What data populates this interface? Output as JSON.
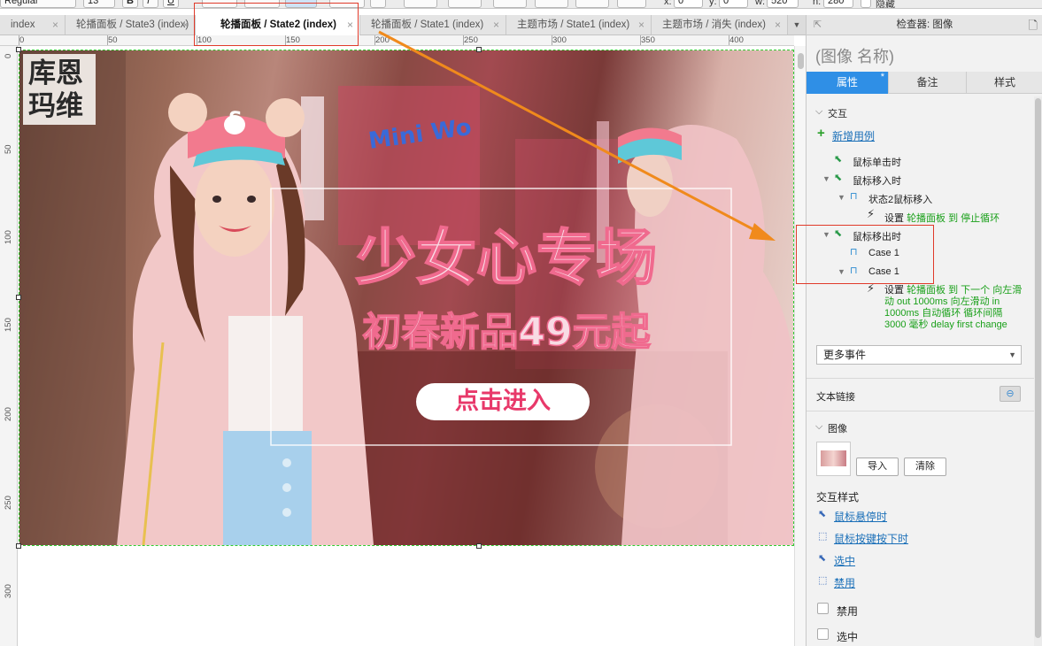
{
  "toolbar": {
    "font_style": "Regular",
    "font_size": "13",
    "bold": "B",
    "italic": "I",
    "underline": "U",
    "x_label": "x:",
    "x_value": "0",
    "y_label": "y:",
    "y_value": "0",
    "w_label": "w:",
    "w_value": "520",
    "h_label": "h:",
    "h_value": "280",
    "hidden_label": "隐藏"
  },
  "tabs": [
    {
      "label": "index"
    },
    {
      "label": "轮播面板 / State3 (index)"
    },
    {
      "label": "轮播面板 / State2 (index)",
      "active": true
    },
    {
      "label": "轮播面板 / State1 (index)"
    },
    {
      "label": "主题市场 / State1 (index)"
    },
    {
      "label": "主题市场 / 消失 (index)"
    }
  ],
  "tab_close": "×",
  "tab_more": "▼",
  "ruler_h": [
    "0",
    "50",
    "100",
    "150",
    "200",
    "250",
    "300",
    "350",
    "400"
  ],
  "ruler_v": [
    "0",
    "50",
    "100",
    "150",
    "200",
    "250",
    "300"
  ],
  "banner": {
    "logo_line1": "库恩",
    "logo_line2": "玛维",
    "headline": "少女心专场",
    "subhead": "初春新品49元起",
    "cta": "点击进入",
    "cap_letter": "S",
    "sign_text": "Mini Wo"
  },
  "panel": {
    "header": "检查器: 图像",
    "title": "(图像 名称)",
    "tabs": [
      "属性",
      "备注",
      "样式"
    ],
    "tab_dot": "*",
    "section_interaction": "交互",
    "add_case": "新增用例",
    "events": {
      "click": "鼠标单击时",
      "mouse_enter": "鼠标移入时",
      "case_state2": "状态2鼠标移入",
      "action1_prefix": "设置",
      "action1_green": "轮播面板 到 停止循环",
      "mouse_leave": "鼠标移出时",
      "case1a": "Case 1",
      "case1b": "Case 1",
      "action2_prefix": "设置",
      "action2_line1": "轮播面板 到 下一个 向左滑",
      "action2_line2": "动 out 1000ms 向左滑动 in",
      "action2_line3": "1000ms 自动循环 循环间隔",
      "action2_line4": "3000 毫秒 delay first change"
    },
    "more_events": "更多事件",
    "text_link": "文本链接",
    "section_image": "图像",
    "import": "导入",
    "clear": "清除",
    "interaction_styles": "交互样式",
    "hover": "鼠标悬停时",
    "pressed": "鼠标按键按下时",
    "selected": "选中",
    "disabled": "禁用",
    "cb_disabled": "禁用",
    "cb_selected": "选中"
  },
  "colors": {
    "accent": "#2f8fe6",
    "selection": "#2fcc2f",
    "annotation": "#e03a2a",
    "arrow": "#f08a1c",
    "action_green": "#1aa01a",
    "headline_pink": "#f06a8e"
  }
}
